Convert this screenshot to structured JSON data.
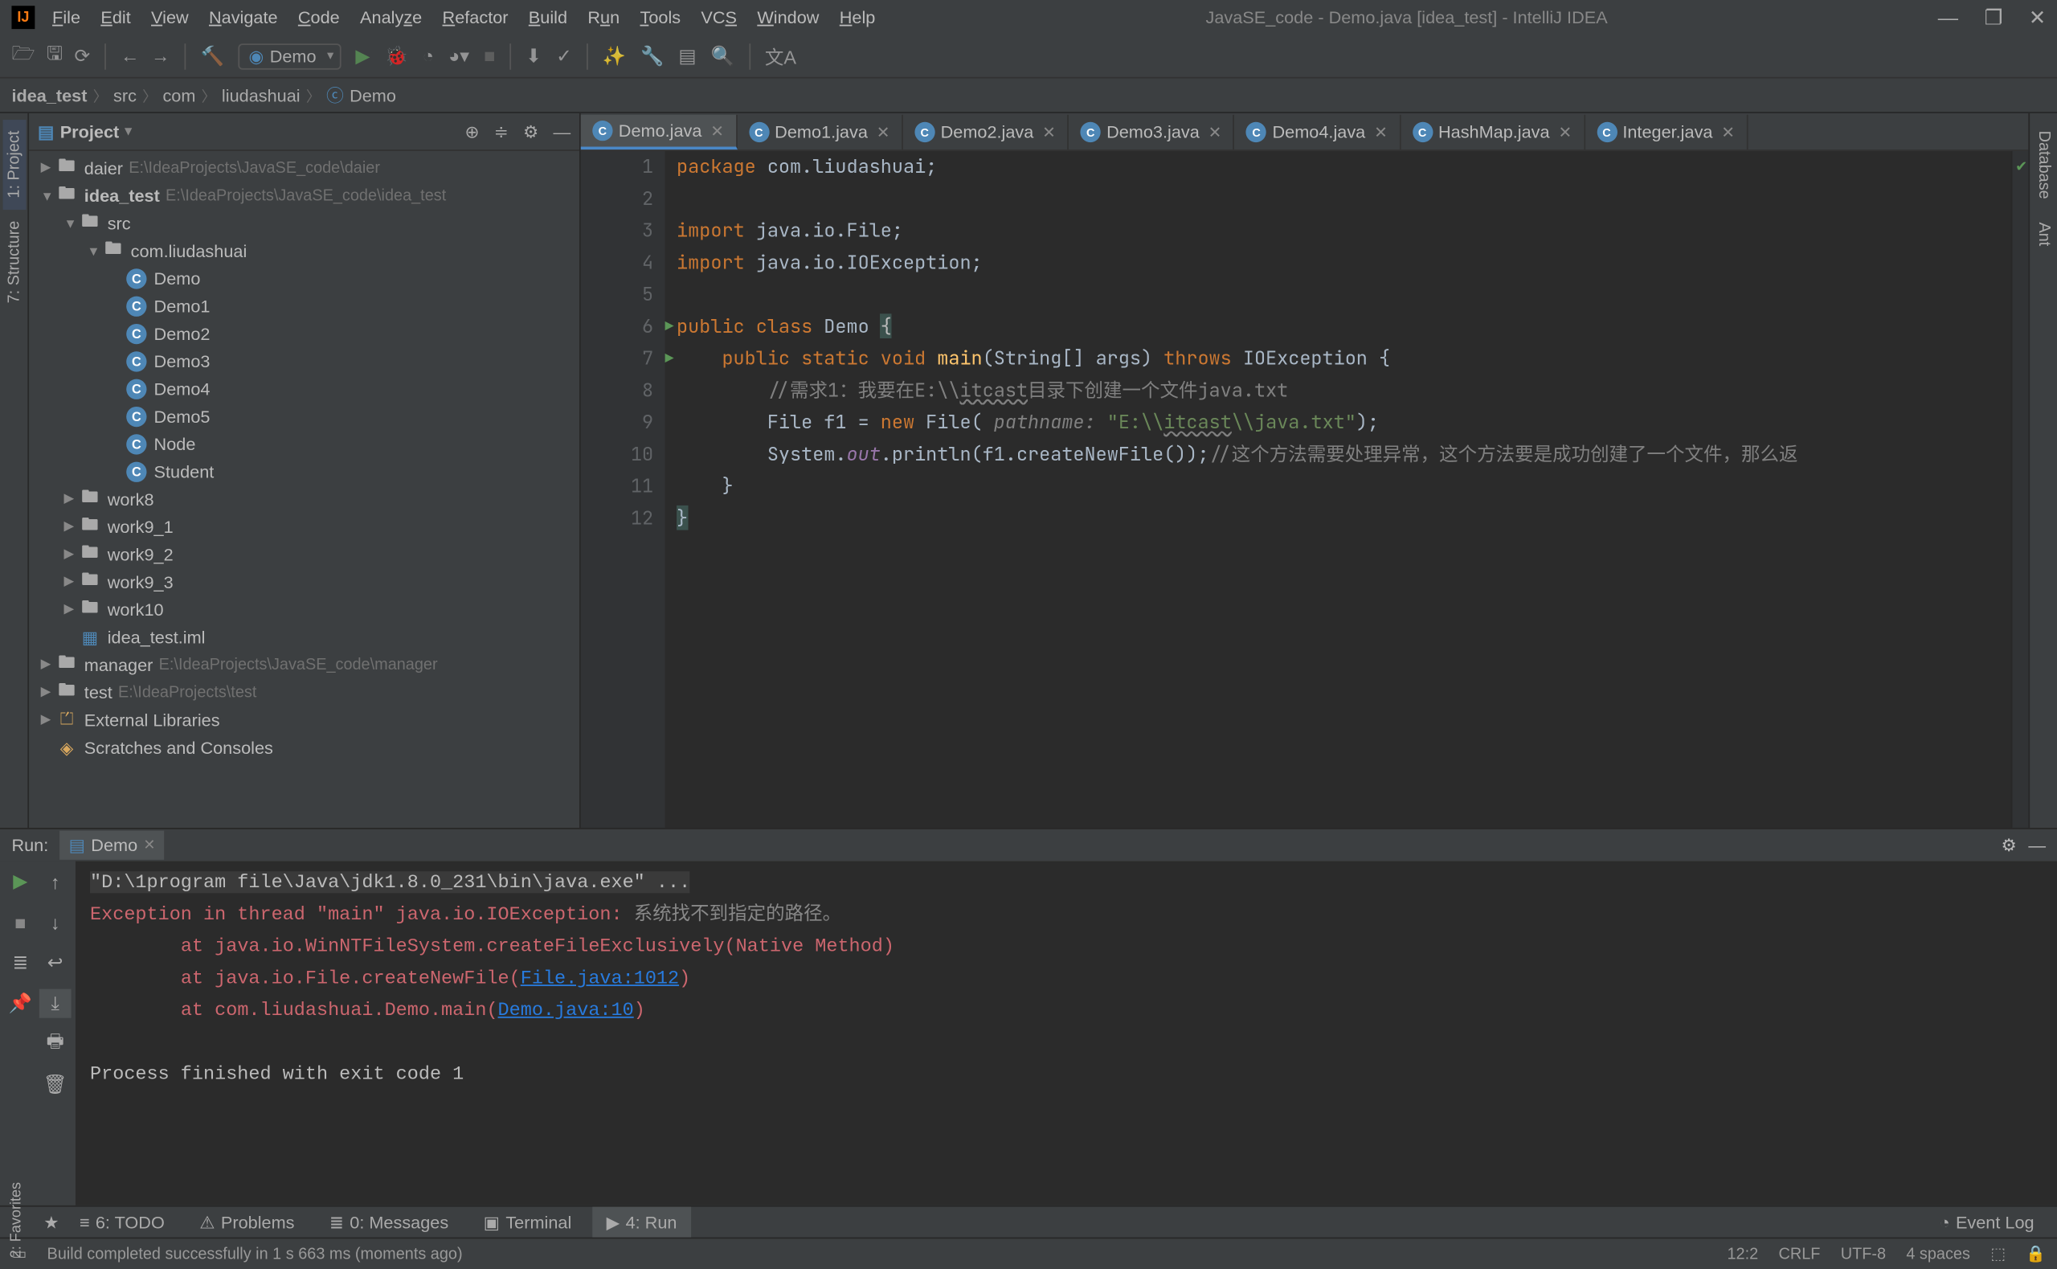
{
  "window": {
    "title": "JavaSE_code - Demo.java [idea_test] - IntelliJ IDEA",
    "menus": [
      "File",
      "Edit",
      "View",
      "Navigate",
      "Code",
      "Analyze",
      "Refactor",
      "Build",
      "Run",
      "Tools",
      "VCS",
      "Window",
      "Help"
    ]
  },
  "toolbar": {
    "run_config": "Demo"
  },
  "breadcrumbs": [
    "idea_test",
    "src",
    "com",
    "liudashuai",
    "Demo"
  ],
  "project_panel": {
    "title": "Project",
    "tree": [
      {
        "d": 0,
        "arrow": "▶",
        "icon": "folder",
        "label": "daier",
        "path": "E:\\IdeaProjects\\JavaSE_code\\daier"
      },
      {
        "d": 0,
        "arrow": "▼",
        "icon": "folder",
        "label": "idea_test",
        "path": "E:\\IdeaProjects\\JavaSE_code\\idea_test",
        "bold": true
      },
      {
        "d": 1,
        "arrow": "▼",
        "icon": "folderopen",
        "label": "src"
      },
      {
        "d": 2,
        "arrow": "▼",
        "icon": "folderopen",
        "label": "com.liudashuai"
      },
      {
        "d": 3,
        "arrow": "",
        "icon": "class",
        "label": "Demo"
      },
      {
        "d": 3,
        "arrow": "",
        "icon": "class",
        "label": "Demo1"
      },
      {
        "d": 3,
        "arrow": "",
        "icon": "class",
        "label": "Demo2"
      },
      {
        "d": 3,
        "arrow": "",
        "icon": "class",
        "label": "Demo3"
      },
      {
        "d": 3,
        "arrow": "",
        "icon": "class",
        "label": "Demo4"
      },
      {
        "d": 3,
        "arrow": "",
        "icon": "class",
        "label": "Demo5"
      },
      {
        "d": 3,
        "arrow": "",
        "icon": "class",
        "label": "Node"
      },
      {
        "d": 3,
        "arrow": "",
        "icon": "class",
        "label": "Student"
      },
      {
        "d": 1,
        "arrow": "▶",
        "icon": "folder",
        "label": "work8"
      },
      {
        "d": 1,
        "arrow": "▶",
        "icon": "folder",
        "label": "work9_1"
      },
      {
        "d": 1,
        "arrow": "▶",
        "icon": "folder",
        "label": "work9_2"
      },
      {
        "d": 1,
        "arrow": "▶",
        "icon": "folder",
        "label": "work9_3"
      },
      {
        "d": 1,
        "arrow": "▶",
        "icon": "folder",
        "label": "work10"
      },
      {
        "d": 1,
        "arrow": "",
        "icon": "module",
        "label": "idea_test.iml"
      },
      {
        "d": 0,
        "arrow": "▶",
        "icon": "folder",
        "label": "manager",
        "path": "E:\\IdeaProjects\\JavaSE_code\\manager"
      },
      {
        "d": 0,
        "arrow": "▶",
        "icon": "folder",
        "label": "test",
        "path": "E:\\IdeaProjects\\test"
      },
      {
        "d": 0,
        "arrow": "▶",
        "icon": "lib",
        "label": "External Libraries"
      },
      {
        "d": 0,
        "arrow": "",
        "icon": "scratch",
        "label": "Scratches and Consoles"
      }
    ]
  },
  "editor_tabs": [
    {
      "label": "Demo.java",
      "active": true,
      "color": "c"
    },
    {
      "label": "Demo1.java",
      "active": false,
      "color": "c"
    },
    {
      "label": "Demo2.java",
      "active": false,
      "color": "c"
    },
    {
      "label": "Demo3.java",
      "active": false,
      "color": "c"
    },
    {
      "label": "Demo4.java",
      "active": false,
      "color": "c"
    },
    {
      "label": "HashMap.java",
      "active": false,
      "color": "c"
    },
    {
      "label": "Integer.java",
      "active": false,
      "color": "c"
    }
  ],
  "code": {
    "lines": [
      1,
      2,
      3,
      4,
      5,
      6,
      7,
      8,
      9,
      10,
      11,
      12
    ],
    "l1_a": "package",
    "l1_b": " com.liudashuai;",
    "l3_a": "import",
    "l3_b": " java.io.File;",
    "l4_a": "import",
    "l4_b": " java.io.IOException;",
    "l6_a": "public class ",
    "l6_b": "Demo ",
    "l6_c": "{",
    "l7_a": "    public static void ",
    "l7_b": "main",
    "l7_c": "(String[] args) ",
    "l7_d": "throws ",
    "l7_e": "IOException {",
    "l8_a": "        ",
    "l8_b": "//需求1：我要在E:\\\\",
    "l8_c": "itcast",
    "l8_d": "目录下创建一个文件java.txt",
    "l9_a": "        File f1 = ",
    "l9_b": "new ",
    "l9_c": "File(",
    "l9_d": " pathname: ",
    "l9_e": "\"E:\\\\",
    "l9_f": "itcast",
    "l9_g": "\\\\java.txt\"",
    "l9_h": ");",
    "l10_a": "        System.",
    "l10_b": "out",
    "l10_c": ".println(f1.createNewFile());",
    "l10_d": "//这个方法需要处理异常，这个方法要是成功创建了一个文件，那么返",
    "l11_a": "    }",
    "l12_a": "}"
  },
  "run_panel": {
    "title": "Run:",
    "tab": "Demo",
    "cmd": "\"D:\\1program file\\Java\\jdk1.8.0_231\\bin\\java.exe\" ...",
    "err1_a": "Exception in thread \"main\" java.io.IOException: ",
    "err1_b": "系统找不到指定的路径。",
    "err2_a": "\tat java.io.WinNTFileSystem.createFileExclusively(Native Method)",
    "err3_a": "\tat java.io.File.createNewFile(",
    "err3_b": "File.java:1012",
    "err3_c": ")",
    "err4_a": "\tat com.liudashuai.Demo.main(",
    "err4_b": "Demo.java:10",
    "err4_c": ")",
    "exit": "Process finished with exit code 1"
  },
  "bottom_tabs": {
    "todo": "6: TODO",
    "problems": "Problems",
    "messages": "0: Messages",
    "terminal": "Terminal",
    "run": "4: Run",
    "eventlog": "Event Log"
  },
  "leftrail": {
    "project": "1: Project",
    "structure": "7: Structure",
    "favorites": "2: Favorites"
  },
  "rightrail": {
    "database": "Database",
    "ant": "Ant"
  },
  "statusbar": {
    "msg": "Build completed successfully in 1 s 663 ms (moments ago)",
    "pos": "12:2",
    "sep": "CRLF",
    "enc": "UTF-8",
    "indent": "4 spaces"
  }
}
